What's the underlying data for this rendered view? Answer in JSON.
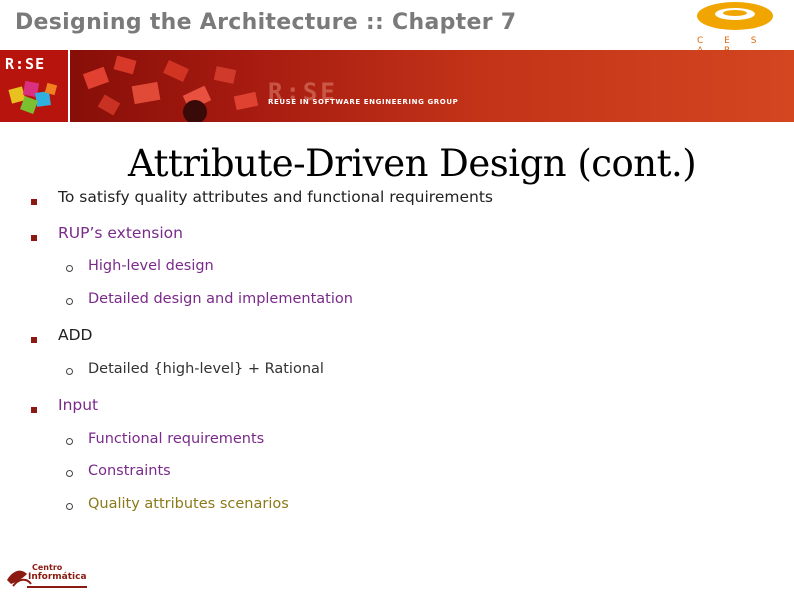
{
  "header": {
    "chapter_title": "Designing the Architecture :: Chapter 7",
    "cesar_label": "C E S A R",
    "rise_label": "R:SE",
    "rise_big": "R:SE",
    "rise_tagline": "REUSE IN SOFTWARE ENGINEERING GROUP"
  },
  "slide": {
    "title": "Attribute-Driven Design (cont.)",
    "bullets": [
      {
        "text": "To satisfy quality attributes and functional requirements",
        "color": "#222222",
        "sub": []
      },
      {
        "text": "RUP’s extension",
        "color": "#7a2a8a",
        "sub": [
          "High-level design",
          "Detailed design and implementation"
        ]
      },
      {
        "text": "ADD",
        "color": "#222222",
        "sub": [
          "Detailed {high-level} + Rational"
        ]
      },
      {
        "text": "Input",
        "color": "#7a2a8a",
        "sub": [
          "Functional requirements",
          "Constraints",
          "Quality attributes scenarios"
        ]
      }
    ]
  },
  "footer": {
    "centro_line1": "Centro",
    "centro_line2": "Informática"
  },
  "colors": {
    "accent": "#8b1a12",
    "purple": "#7a2a8a",
    "olive": "#8a7a1a",
    "cesar_orange": "#f0a500"
  }
}
